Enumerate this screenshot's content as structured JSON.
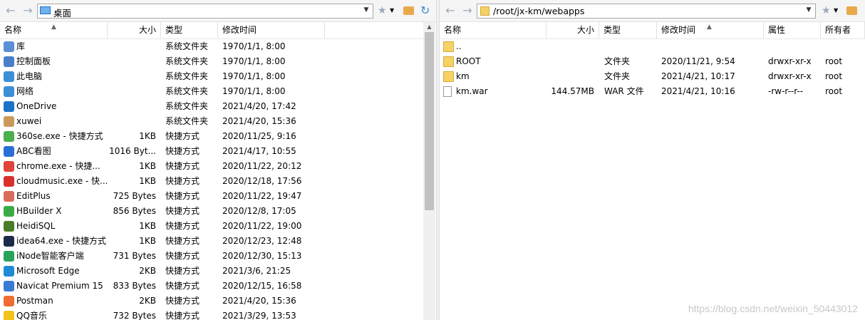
{
  "left": {
    "address": "桌面",
    "columns": {
      "name": "名称",
      "size": "大小",
      "type": "类型",
      "modified": "修改时间"
    },
    "rows": [
      {
        "icon": "library-icon",
        "color": "#5b8fd6",
        "name": "库",
        "size": "",
        "type": "系统文件夹",
        "modified": "1970/1/1, 8:00"
      },
      {
        "icon": "control-panel-icon",
        "color": "#4a7fc9",
        "name": "控制面板",
        "size": "",
        "type": "系统文件夹",
        "modified": "1970/1/1, 8:00"
      },
      {
        "icon": "this-pc-icon",
        "color": "#3d8fd8",
        "name": "此电脑",
        "size": "",
        "type": "系统文件夹",
        "modified": "1970/1/1, 8:00"
      },
      {
        "icon": "network-icon",
        "color": "#3d8fd8",
        "name": "网络",
        "size": "",
        "type": "系统文件夹",
        "modified": "1970/1/1, 8:00"
      },
      {
        "icon": "onedrive-icon",
        "color": "#1a73c8",
        "name": "OneDrive",
        "size": "",
        "type": "系统文件夹",
        "modified": "2021/4/20, 17:42"
      },
      {
        "icon": "user-icon",
        "color": "#c99a5a",
        "name": "xuwei",
        "size": "",
        "type": "系统文件夹",
        "modified": "2021/4/20, 15:36"
      },
      {
        "icon": "360se-icon",
        "color": "#4cae4c",
        "name": "360se.exe - 快捷方式",
        "size": "1KB",
        "type": "快捷方式",
        "modified": "2020/11/25, 9:16"
      },
      {
        "icon": "abc-viewer-icon",
        "color": "#2a6fd6",
        "name": "ABC看图",
        "size": "1016 Byt...",
        "type": "快捷方式",
        "modified": "2021/4/17, 10:55"
      },
      {
        "icon": "chrome-icon",
        "color": "#e0443b",
        "name": "chrome.exe - 快捷...",
        "size": "1KB",
        "type": "快捷方式",
        "modified": "2020/11/22, 20:12"
      },
      {
        "icon": "cloudmusic-icon",
        "color": "#d9302d",
        "name": "cloudmusic.exe - 快...",
        "size": "1KB",
        "type": "快捷方式",
        "modified": "2020/12/18, 17:56"
      },
      {
        "icon": "editplus-icon",
        "color": "#d96c5a",
        "name": "EditPlus",
        "size": "725 Bytes",
        "type": "快捷方式",
        "modified": "2020/11/22, 19:47"
      },
      {
        "icon": "hbuilder-icon",
        "color": "#3bab48",
        "name": "HBuilder X",
        "size": "856 Bytes",
        "type": "快捷方式",
        "modified": "2020/12/8, 17:05"
      },
      {
        "icon": "heidisql-icon",
        "color": "#4a7d2a",
        "name": "HeidiSQL",
        "size": "1KB",
        "type": "快捷方式",
        "modified": "2020/11/22, 19:00"
      },
      {
        "icon": "idea-icon",
        "color": "#1c2b4a",
        "name": "idea64.exe - 快捷方式",
        "size": "1KB",
        "type": "快捷方式",
        "modified": "2020/12/23, 12:48"
      },
      {
        "icon": "inode-icon",
        "color": "#29a35a",
        "name": "iNode智能客户端",
        "size": "731 Bytes",
        "type": "快捷方式",
        "modified": "2020/12/30, 15:13"
      },
      {
        "icon": "edge-icon",
        "color": "#1f8bd6",
        "name": "Microsoft Edge",
        "size": "2KB",
        "type": "快捷方式",
        "modified": "2021/3/6, 21:25"
      },
      {
        "icon": "navicat-icon",
        "color": "#3a7bd5",
        "name": "Navicat Premium 15",
        "size": "833 Bytes",
        "type": "快捷方式",
        "modified": "2020/12/15, 16:58"
      },
      {
        "icon": "postman-icon",
        "color": "#ef6c33",
        "name": "Postman",
        "size": "2KB",
        "type": "快捷方式",
        "modified": "2021/4/20, 15:36"
      },
      {
        "icon": "qqmusic-icon",
        "color": "#f2c31a",
        "name": "QQ音乐",
        "size": "732 Bytes",
        "type": "快捷方式",
        "modified": "2021/3/29, 13:53"
      }
    ]
  },
  "right": {
    "address": "/root/jx-km/webapps",
    "columns": {
      "name": "名称",
      "size": "大小",
      "type": "类型",
      "modified": "修改时间",
      "perms": "属性",
      "owner": "所有者"
    },
    "rows": [
      {
        "kind": "folder",
        "name": "..",
        "size": "",
        "type": "",
        "modified": "",
        "perms": "",
        "owner": ""
      },
      {
        "kind": "folder",
        "name": "ROOT",
        "size": "",
        "type": "文件夹",
        "modified": "2020/11/21, 9:54",
        "perms": "drwxr-xr-x",
        "owner": "root"
      },
      {
        "kind": "folder",
        "name": "km",
        "size": "",
        "type": "文件夹",
        "modified": "2021/4/21, 10:17",
        "perms": "drwxr-xr-x",
        "owner": "root"
      },
      {
        "kind": "file",
        "name": "km.war",
        "size": "144.57MB",
        "type": "WAR 文件",
        "modified": "2021/4/21, 10:16",
        "perms": "-rw-r--r--",
        "owner": "root"
      }
    ]
  },
  "watermark": "https://blog.csdn.net/weixin_50443012"
}
